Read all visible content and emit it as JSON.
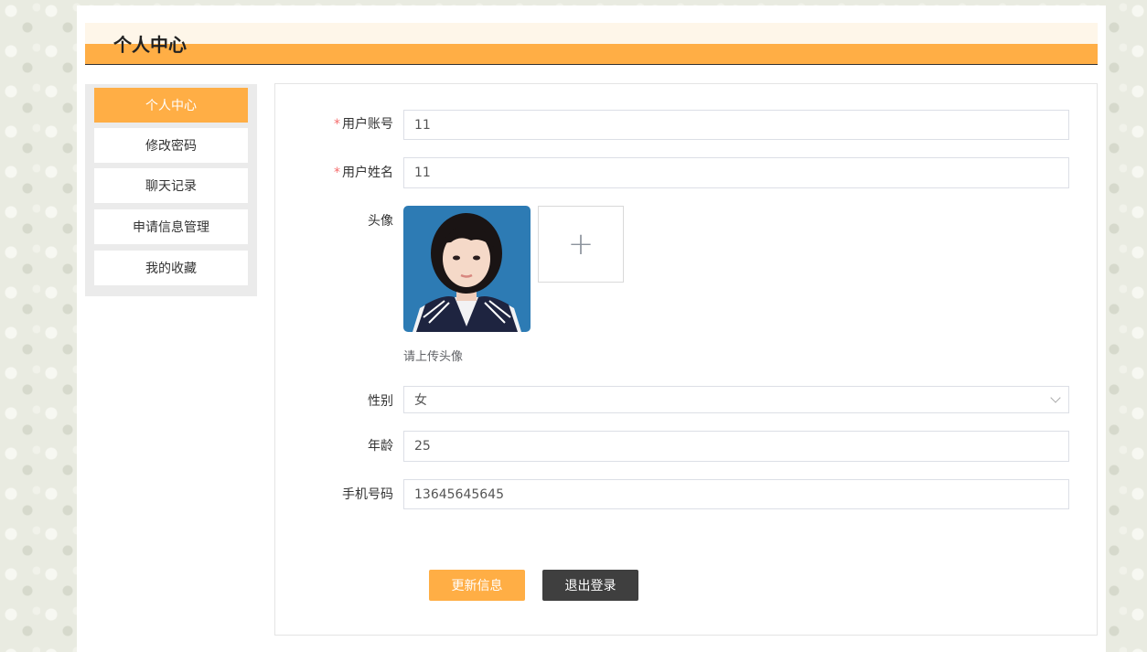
{
  "header": {
    "title": "个人中心"
  },
  "sidebar": {
    "items": [
      {
        "label": "个人中心"
      },
      {
        "label": "修改密码"
      },
      {
        "label": "聊天记录"
      },
      {
        "label": "申请信息管理"
      },
      {
        "label": "我的收藏"
      }
    ]
  },
  "form": {
    "account": {
      "label": "用户账号",
      "required": "*",
      "value": "11"
    },
    "name": {
      "label": "用户姓名",
      "required": "*",
      "value": "11"
    },
    "avatar": {
      "label": "头像",
      "hint": "请上传头像",
      "upload_icon": "+"
    },
    "gender": {
      "label": "性别",
      "value": "女"
    },
    "age": {
      "label": "年龄",
      "value": "25"
    },
    "phone": {
      "label": "手机号码",
      "value": "13645645645"
    }
  },
  "buttons": {
    "update": "更新信息",
    "logout": "退出登录"
  },
  "colors": {
    "accent": "#ffae45",
    "dark_button": "#3f3f3f"
  }
}
